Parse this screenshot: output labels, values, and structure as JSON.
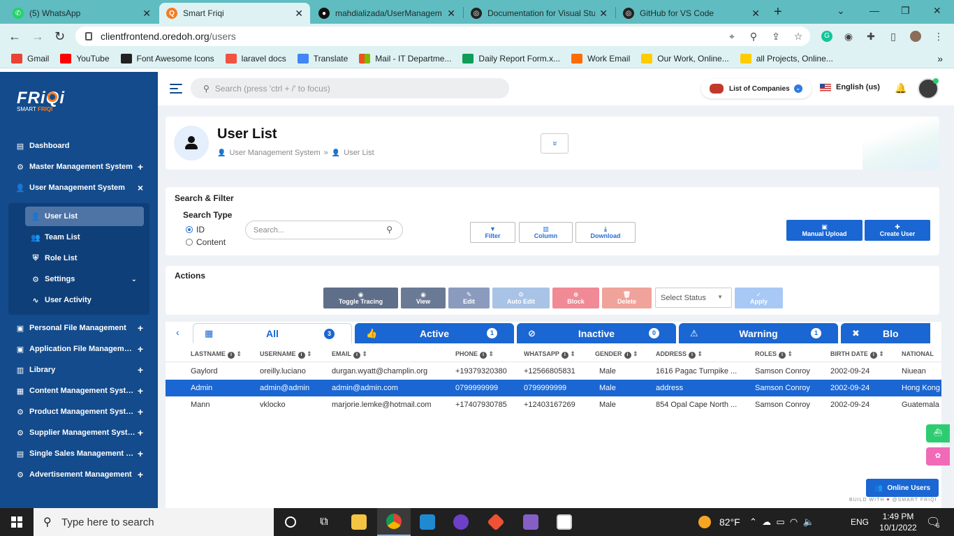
{
  "browser": {
    "tabs": [
      {
        "title": "(5) WhatsApp",
        "color": "#25d366",
        "glyph": "✆"
      },
      {
        "title": "Smart Friqi",
        "color": "#f47c20",
        "glyph": "Q"
      },
      {
        "title": "mahdializada/UserManagem",
        "color": "#111111",
        "glyph": "●"
      },
      {
        "title": "Documentation for Visual Stu",
        "color": "#222222",
        "glyph": "◎"
      },
      {
        "title": "GitHub for VS Code",
        "color": "#222222",
        "glyph": "◎"
      }
    ],
    "url_host": "clientfrontend.oredoh.org",
    "url_path": "/users",
    "bookmarks": [
      {
        "label": "Gmail",
        "color": "#ea4335"
      },
      {
        "label": "YouTube",
        "color": "#ff0000"
      },
      {
        "label": "Font Awesome Icons",
        "color": "#222222"
      },
      {
        "label": "laravel docs",
        "color": "#f05340"
      },
      {
        "label": "Translate",
        "color": "#4285f4"
      },
      {
        "label": "Mail - IT Departme...",
        "color": "#f25022"
      },
      {
        "label": "Daily Report Form.x...",
        "color": "#0f9d58"
      },
      {
        "label": "Work Email",
        "color": "#ff6d00"
      },
      {
        "label": "Our Work, Online...",
        "color": "#ffcc00"
      },
      {
        "label": "all Projects, Online...",
        "color": "#ffcc00"
      }
    ]
  },
  "sidebar": {
    "logo_text": "FRiQi",
    "logo_sub_a": "SMART",
    "logo_sub_b": "FRIQI",
    "items": [
      {
        "label": "Dashboard",
        "icon": "dashboard-icon",
        "glyph": "▤",
        "suffix": ""
      },
      {
        "label": "Master Management System",
        "icon": "gear-icon",
        "glyph": "⚙",
        "suffix": "+"
      },
      {
        "label": "User Management System",
        "icon": "users-icon",
        "glyph": "👤",
        "suffix": "×"
      },
      {
        "label": "Personal File Management",
        "icon": "file-icon",
        "glyph": "▣",
        "suffix": "+"
      },
      {
        "label": "Application File Management",
        "icon": "file-icon",
        "glyph": "▣",
        "suffix": "+"
      },
      {
        "label": "Library",
        "icon": "library-icon",
        "glyph": "▥",
        "suffix": "+"
      },
      {
        "label": "Content Management System",
        "icon": "content-icon",
        "glyph": "▦",
        "suffix": "+"
      },
      {
        "label": "Product Management System",
        "icon": "product-icon",
        "glyph": "⚙",
        "suffix": "+"
      },
      {
        "label": "Supplier Management System",
        "icon": "supplier-icon",
        "glyph": "⚙",
        "suffix": "+"
      },
      {
        "label": "Single Sales Management System",
        "icon": "sales-icon",
        "glyph": "▤",
        "suffix": "+"
      },
      {
        "label": "Advertisement Management",
        "icon": "ad-icon",
        "glyph": "⚙",
        "suffix": "+"
      }
    ],
    "sub_items": [
      {
        "label": "User List",
        "glyph": "👤"
      },
      {
        "label": "Team List",
        "glyph": "👥"
      },
      {
        "label": "Role List",
        "glyph": "⛨"
      },
      {
        "label": "Settings",
        "glyph": "⚙"
      },
      {
        "label": "User Activity",
        "glyph": "∿"
      }
    ]
  },
  "header": {
    "search_placeholder": "Search (press 'ctrl + /' to focus)",
    "companies_label": "List of Companies",
    "language": "English (us)"
  },
  "page": {
    "title": "User List",
    "crumb_1": "User Management System",
    "crumb_sep": "»",
    "crumb_2": "User List",
    "collapse_glyph": "»"
  },
  "filter": {
    "section_title": "Search & Filter",
    "search_type_label": "Search Type",
    "radio_id": "ID",
    "radio_content": "Content",
    "search_placeholder": "Search...",
    "btn_filter": "Filter",
    "btn_column": "Column",
    "btn_download": "Download",
    "btn_manual_upload": "Manual Upload",
    "btn_create_user": "Create User"
  },
  "actions": {
    "section_title": "Actions",
    "toggle_tracing": "Toggle Tracing",
    "view": "View",
    "edit": "Edit",
    "auto_edit": "Auto Edit",
    "block": "Block",
    "delete": "Delete",
    "select_status": "Select Status",
    "apply": "Apply",
    "colors": {
      "toggle": "#5f6f8a",
      "view": "#6a7a94",
      "edit": "#8a9bbd",
      "auto_edit": "#a9c3e6",
      "block": "#f08a95",
      "delete": "#f0a39a",
      "apply": "#a8c9f5"
    }
  },
  "status_tabs": [
    {
      "label": "All",
      "count": "3",
      "glyph": "▦"
    },
    {
      "label": "Active",
      "count": "1",
      "glyph": "👍"
    },
    {
      "label": "Inactive",
      "count": "0",
      "glyph": "⊘"
    },
    {
      "label": "Warning",
      "count": "1",
      "glyph": "⚠"
    },
    {
      "label": "Blo",
      "count": "",
      "glyph": "✖"
    }
  ],
  "table": {
    "headers": [
      "LASTNAME",
      "USERNAME",
      "EMAIL",
      "PHONE",
      "WHATSAPP",
      "GENDER",
      "ADDRESS",
      "ROLES",
      "BIRTH DATE",
      "NATIONAL"
    ],
    "rows": [
      [
        "Gaylord",
        "oreilly.luciano",
        "durgan.wyatt@champlin.org",
        "+19379320380",
        "+12566805831",
        "Male",
        "1616 Pagac Turnpike ...",
        "Samson Conroy",
        "2002-09-24",
        "Niuean"
      ],
      [
        "Admin",
        "admin@admin",
        "admin@admin.com",
        "0799999999",
        "0799999999",
        "Male",
        "address",
        "Samson Conroy",
        "2002-09-24",
        "Hong Kong"
      ],
      [
        "Mann",
        "vklocko",
        "marjorie.lemke@hotmail.com",
        "+17407930785",
        "+12403167269",
        "Male",
        "854 Opal Cape North ...",
        "Samson Conroy",
        "2002-09-24",
        "Guatemala"
      ]
    ]
  },
  "footer": {
    "build_text": "BUILD WITH",
    "build_heart": "♥",
    "build_brand": "@SMART FRIQI",
    "online_users": "Online Users"
  },
  "taskbar": {
    "search_placeholder": "Type here to search",
    "weather": "82°F",
    "lang": "ENG",
    "time": "1:49 PM",
    "date": "10/1/2022",
    "notif_count": "6"
  }
}
